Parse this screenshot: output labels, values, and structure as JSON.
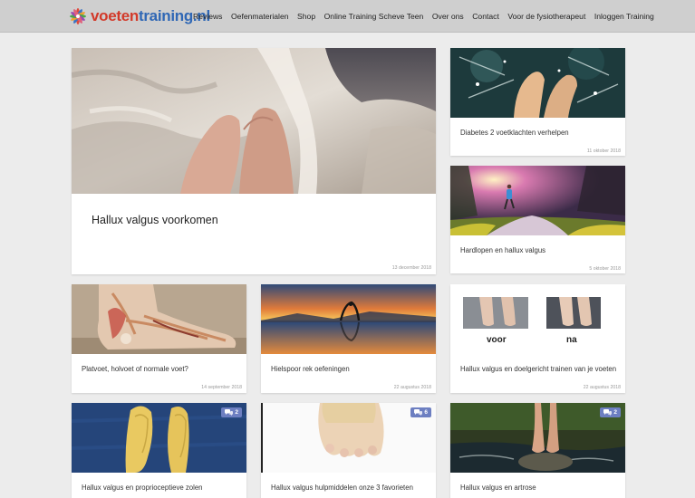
{
  "brand": {
    "word1": "voeten",
    "word2": "training.nl"
  },
  "nav": {
    "reviews": "Reviews",
    "oefenmaterialen": "Oefenmaterialen",
    "shop": "Shop",
    "online_training": "Online Training Scheve Teen",
    "over_ons": "Over ons",
    "contact": "Contact",
    "fysiotherapeut": "Voor de fysiotherapeut",
    "inloggen": "Inloggen Training"
  },
  "posts": [
    {
      "title": "Hallux valgus voorkomen",
      "date": "13 december 2018"
    },
    {
      "title": "Diabetes 2 voetklachten verhelpen",
      "date": "11 oktober 2018"
    },
    {
      "title": "Hardlopen en hallux valgus",
      "date": "5 oktober 2018"
    },
    {
      "title": "Platvoet, holvoet of normale voet?",
      "date": "14 september 2018"
    },
    {
      "title": "Hielspoor rek oefeningen",
      "date": "22 augustus 2018"
    },
    {
      "title": "Hallux valgus en doelgericht trainen van je voeten",
      "date": "22 augustus 2018",
      "img_label_before": "voor",
      "img_label_after": "na"
    },
    {
      "title": "Hallux valgus en proprioceptieve zolen",
      "comments": "2"
    },
    {
      "title": "Hallux valgus hulpmiddelen onze 3 favorieten",
      "comments": "6"
    },
    {
      "title": "Hallux valgus en artrose",
      "comments": "2"
    }
  ],
  "colors": {
    "topbar": "#cfcfcf",
    "badge": "#6d7fc1",
    "brand_red": "#d23a2a",
    "brand_blue": "#2f67b5"
  }
}
